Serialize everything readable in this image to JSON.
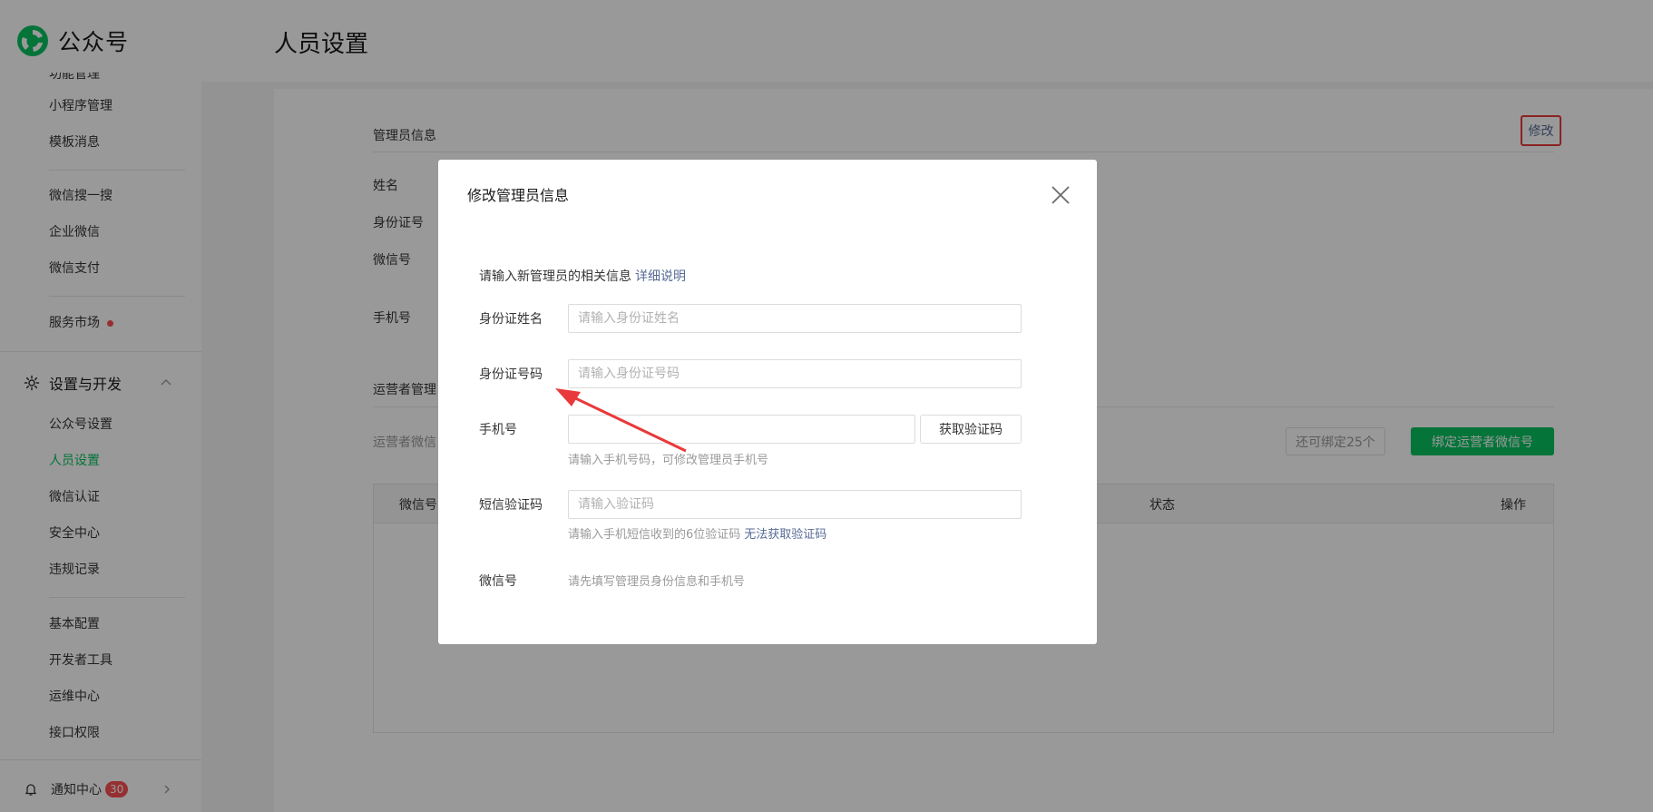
{
  "brand": {
    "name": "公众号"
  },
  "header": {
    "title": "人员设置"
  },
  "sidebar": {
    "clipped_item": "功能管理",
    "items_top": [
      {
        "label": "小程序管理"
      },
      {
        "label": "模板消息"
      }
    ],
    "items_mid": [
      {
        "label": "微信搜一搜"
      },
      {
        "label": "企业微信"
      },
      {
        "label": "微信支付"
      }
    ],
    "market": {
      "label": "服务市场"
    },
    "group": {
      "label": "设置与开发"
    },
    "items_settings": [
      {
        "label": "公众号设置"
      },
      {
        "label": "人员设置"
      },
      {
        "label": "微信认证"
      },
      {
        "label": "安全中心"
      },
      {
        "label": "违规记录"
      }
    ],
    "items_dev": [
      {
        "label": "基本配置"
      },
      {
        "label": "开发者工具"
      },
      {
        "label": "运维中心"
      },
      {
        "label": "接口权限"
      }
    ],
    "notice": {
      "label": "通知中心",
      "count": "30"
    }
  },
  "main": {
    "admin_section": "管理员信息",
    "edit_label": "修改",
    "fields": {
      "name": "姓名",
      "id": "身份证号",
      "wechat": "微信号",
      "phone": "手机号"
    },
    "operator_section": "运营者管理",
    "operator_desc": "运营者微信",
    "remain_label": "还可绑定25个",
    "bind_label": "绑定运营者微信号",
    "table_headers": {
      "wechat": "微信号",
      "status": "状态",
      "action": "操作"
    }
  },
  "dialog": {
    "title": "修改管理员信息",
    "intro": "请输入新管理员的相关信息",
    "intro_link": "详细说明",
    "name_label": "身份证姓名",
    "name_placeholder": "请输入身份证姓名",
    "id_label": "身份证号码",
    "id_placeholder": "请输入身份证号码",
    "phone_label": "手机号",
    "phone_hint": "请输入手机号码，可修改管理员手机号",
    "get_code_label": "获取验证码",
    "sms_label": "短信验证码",
    "sms_placeholder": "请输入验证码",
    "sms_hint": "请输入手机短信收到的6位验证码",
    "sms_link": "无法获取验证码",
    "wechat_label": "微信号",
    "wechat_hint": "请先填写管理员身份信息和手机号"
  },
  "colors": {
    "accent": "#07c160",
    "link": "#576b95",
    "badge": "#fa5151",
    "annotation": "#e83a3a"
  }
}
